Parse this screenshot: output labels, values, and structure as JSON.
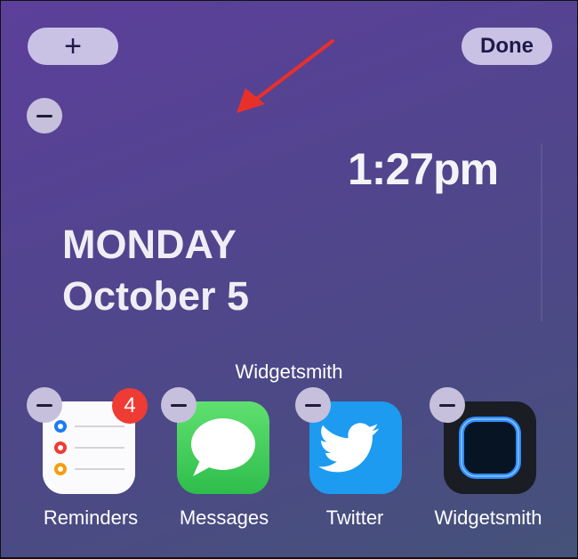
{
  "toolbar": {
    "add_label": "+",
    "done_label": "Done"
  },
  "clock_widget": {
    "time": "1:27pm",
    "day": "MONDAY",
    "date": "October 5"
  },
  "widget_label": "Widgetsmith",
  "apps": [
    {
      "name": "Reminders",
      "badge": "4",
      "icon": "reminders-icon"
    },
    {
      "name": "Messages",
      "icon": "messages-icon"
    },
    {
      "name": "Twitter",
      "icon": "twitter-icon"
    },
    {
      "name": "Widgetsmith",
      "icon": "widgetsmith-icon"
    }
  ],
  "colors": {
    "annotation_arrow": "#e8302a",
    "badge": "#ee3b34",
    "messages_green": "#34c759",
    "twitter_blue": "#1d9bf0",
    "widgetsmith_glow": "#2f8cff"
  }
}
